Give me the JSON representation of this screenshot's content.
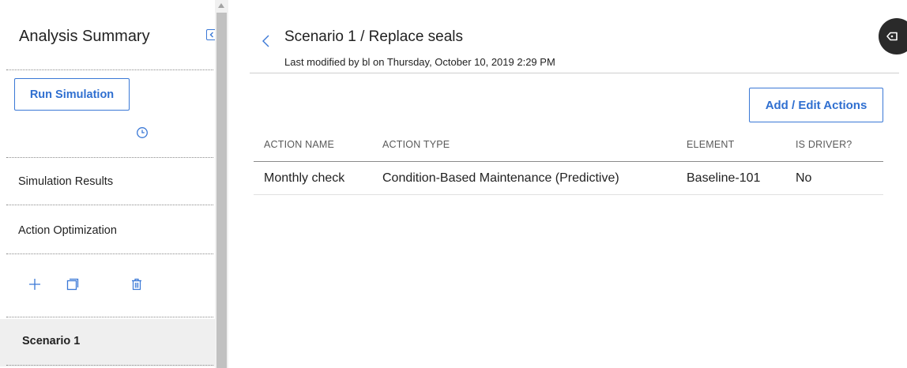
{
  "sidebar": {
    "title": "Analysis Summary",
    "run_button": "Run Simulation",
    "items": [
      {
        "label": "Simulation Results"
      },
      {
        "label": "Action Optimization"
      }
    ],
    "selected_scenario": "Scenario 1",
    "icons": [
      "collapse-panel-icon",
      "clock-icon",
      "plus-icon",
      "copy-icon",
      "trash-icon"
    ]
  },
  "header": {
    "title": "Scenario 1 / Replace seals",
    "subtitle": "Last modified by bl on Thursday, October 10, 2019 2:29 PM"
  },
  "toolbar": {
    "add_edit_label": "Add / Edit Actions"
  },
  "table": {
    "columns": [
      "ACTION NAME",
      "ACTION TYPE",
      "ELEMENT",
      "IS DRIVER?"
    ],
    "rows": [
      [
        "Monthly check",
        "Condition-Based Maintenance (Predictive)",
        "Baseline-101",
        "No"
      ]
    ]
  },
  "colors": {
    "accent": "#2f6fd0",
    "selected_bg": "#efefef",
    "help_bubble": "#2a2a2a"
  }
}
